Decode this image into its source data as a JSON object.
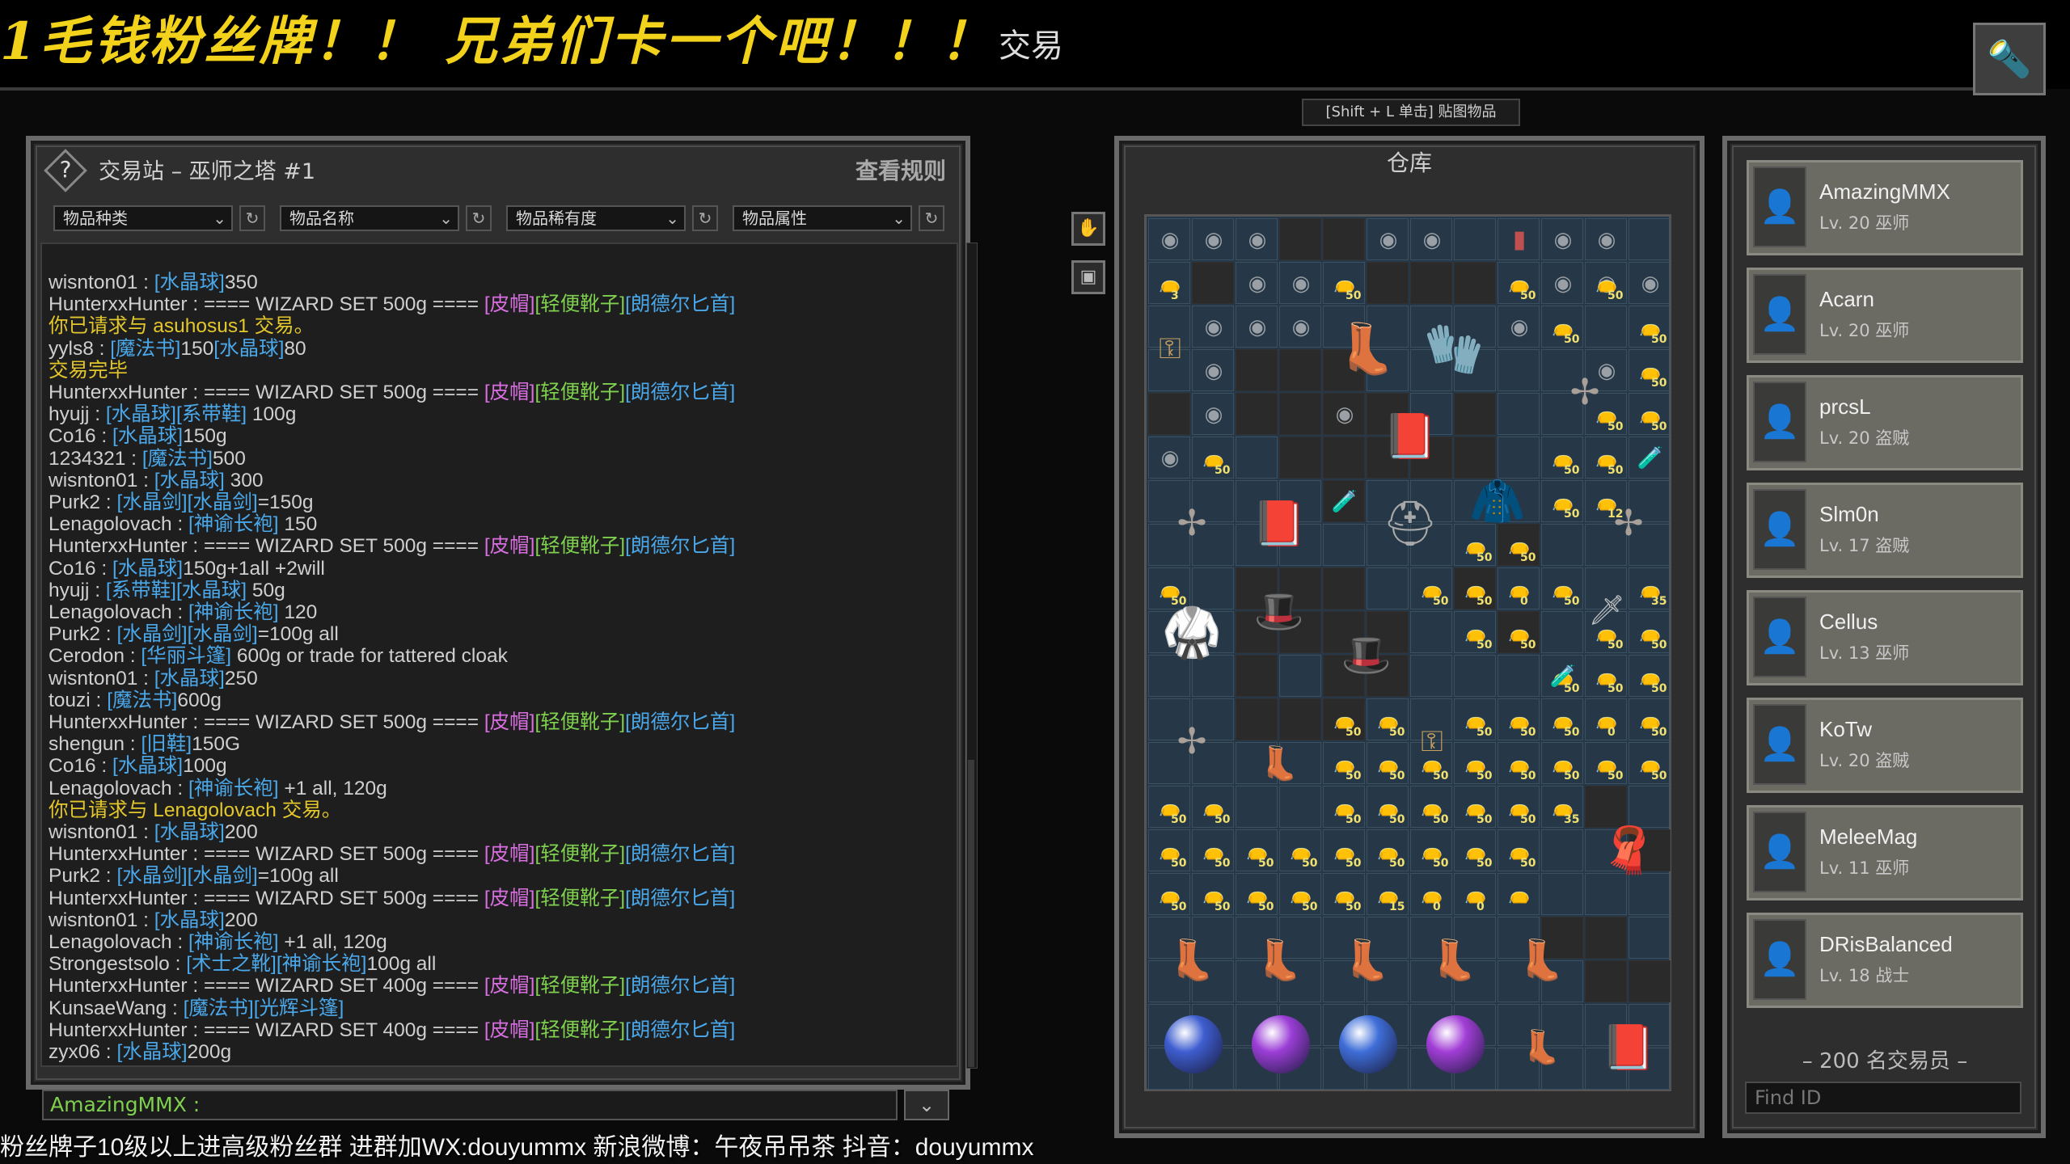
{
  "overlay": {
    "banner": "1毛钱粉丝牌！！ 兄弟们卡一个吧！！！",
    "footer": "粉丝牌子10级以上进高级粉丝群  进群加WX:douyummx 新浪微博：午夜吊吊茶   抖音：douyummx"
  },
  "header": {
    "title": "交易",
    "paste_hint": "[Shift + L 单击] 贴图物品"
  },
  "trade_panel": {
    "title": "交易站 – 巫师之塔 #1",
    "rules_label": "查看规则",
    "filters": [
      "物品种类",
      "物品名称",
      "物品稀有度",
      "物品属性"
    ],
    "input_prefix": "AmazingMMX :",
    "messages": [
      [
        [
          "wisnton01 : ",
          "w"
        ],
        [
          "[水晶球]",
          "b"
        ],
        [
          "350",
          "w"
        ]
      ],
      [
        [
          "HunterxxHunter : ==== WIZARD SET 500g ==== ",
          "w"
        ],
        [
          "[皮帽]",
          "p"
        ],
        [
          "[轻便靴子]",
          "g"
        ],
        [
          "[朗德尔匕首]",
          "b"
        ]
      ],
      [
        [
          "你已请求与 asuhosus1 交易。",
          "y"
        ]
      ],
      [
        [
          "yyls8 : ",
          "w"
        ],
        [
          "[魔法书]",
          "b"
        ],
        [
          "150",
          "w"
        ],
        [
          "[水晶球]",
          "b"
        ],
        [
          "80",
          "w"
        ]
      ],
      [
        [
          "交易完毕",
          "y"
        ]
      ],
      [
        [
          "HunterxxHunter : ==== WIZARD SET 500g ==== ",
          "w"
        ],
        [
          "[皮帽]",
          "p"
        ],
        [
          "[轻便靴子]",
          "g"
        ],
        [
          "[朗德尔匕首]",
          "b"
        ]
      ],
      [
        [
          "hyujj : ",
          "w"
        ],
        [
          "[水晶球]",
          "b"
        ],
        [
          "[系带鞋]",
          "b"
        ],
        [
          " 100g",
          "w"
        ]
      ],
      [
        [
          "Co16 : ",
          "w"
        ],
        [
          "[水晶球]",
          "b"
        ],
        [
          "150g",
          "w"
        ]
      ],
      [
        [
          "1234321 : ",
          "w"
        ],
        [
          "[魔法书]",
          "b"
        ],
        [
          "500",
          "w"
        ]
      ],
      [
        [
          "wisnton01 : ",
          "w"
        ],
        [
          "[水晶球]",
          "b"
        ],
        [
          " 300",
          "w"
        ]
      ],
      [
        [
          "Purk2 : ",
          "w"
        ],
        [
          "[水晶剑]",
          "b"
        ],
        [
          "[水晶剑]",
          "b"
        ],
        [
          "=150g",
          "w"
        ]
      ],
      [
        [
          "Lenagolovach : ",
          "w"
        ],
        [
          "[神谕长袍]",
          "b"
        ],
        [
          " 150",
          "w"
        ]
      ],
      [
        [
          "HunterxxHunter : ==== WIZARD SET 500g ==== ",
          "w"
        ],
        [
          "[皮帽]",
          "p"
        ],
        [
          "[轻便靴子]",
          "g"
        ],
        [
          "[朗德尔匕首]",
          "b"
        ]
      ],
      [
        [
          "Co16 : ",
          "w"
        ],
        [
          "[水晶球]",
          "b"
        ],
        [
          "150g+1all   +2will",
          "w"
        ]
      ],
      [
        [
          "hyujj : ",
          "w"
        ],
        [
          "[系带鞋]",
          "b"
        ],
        [
          "[水晶球]",
          "b"
        ],
        [
          " 50g",
          "w"
        ]
      ],
      [
        [
          "Lenagolovach : ",
          "w"
        ],
        [
          "[神谕长袍]",
          "b"
        ],
        [
          " 120",
          "w"
        ]
      ],
      [
        [
          "Purk2 : ",
          "w"
        ],
        [
          "[水晶剑]",
          "b"
        ],
        [
          "[水晶剑]",
          "b"
        ],
        [
          "=100g  all",
          "w"
        ]
      ],
      [
        [
          "Cerodon : ",
          "w"
        ],
        [
          "[华丽斗篷]",
          "b"
        ],
        [
          " 600g or trade for tattered cloak",
          "w"
        ]
      ],
      [
        [
          "wisnton01 : ",
          "w"
        ],
        [
          "[水晶球]",
          "b"
        ],
        [
          "250",
          "w"
        ]
      ],
      [
        [
          "touzi : ",
          "w"
        ],
        [
          "[魔法书]",
          "b"
        ],
        [
          "600g",
          "w"
        ]
      ],
      [
        [
          "HunterxxHunter : ==== WIZARD SET 500g ==== ",
          "w"
        ],
        [
          "[皮帽]",
          "p"
        ],
        [
          "[轻便靴子]",
          "g"
        ],
        [
          "[朗德尔匕首]",
          "b"
        ]
      ],
      [
        [
          "shengun : ",
          "w"
        ],
        [
          "[旧鞋]",
          "b"
        ],
        [
          "150G",
          "w"
        ]
      ],
      [
        [
          "Co16 : ",
          "w"
        ],
        [
          "[水晶球]",
          "b"
        ],
        [
          "100g",
          "w"
        ]
      ],
      [
        [
          "Lenagolovach : ",
          "w"
        ],
        [
          "[神谕长袍]",
          "b"
        ],
        [
          " +1 all, 120g",
          "w"
        ]
      ],
      [
        [
          "你已请求与 Lenagolovach 交易。",
          "y"
        ]
      ],
      [
        [
          "wisnton01 : ",
          "w"
        ],
        [
          "[水晶球]",
          "b"
        ],
        [
          "200",
          "w"
        ]
      ],
      [
        [
          "HunterxxHunter : ==== WIZARD SET 500g ==== ",
          "w"
        ],
        [
          "[皮帽]",
          "p"
        ],
        [
          "[轻便靴子]",
          "g"
        ],
        [
          "[朗德尔匕首]",
          "b"
        ]
      ],
      [
        [
          "Purk2 : ",
          "w"
        ],
        [
          "[水晶剑]",
          "b"
        ],
        [
          "[水晶剑]",
          "b"
        ],
        [
          "=100g all",
          "w"
        ]
      ],
      [
        [
          "HunterxxHunter : ==== WIZARD SET 500g ==== ",
          "w"
        ],
        [
          "[皮帽]",
          "p"
        ],
        [
          "[轻便靴子]",
          "g"
        ],
        [
          "[朗德尔匕首]",
          "b"
        ]
      ],
      [
        [
          "wisnton01 : ",
          "w"
        ],
        [
          "[水晶球]",
          "b"
        ],
        [
          "200",
          "w"
        ]
      ],
      [
        [
          "Lenagolovach : ",
          "w"
        ],
        [
          "[神谕长袍]",
          "b"
        ],
        [
          " +1 all, 120g",
          "w"
        ]
      ],
      [
        [
          "Strongestsolo : ",
          "w"
        ],
        [
          "[术士之靴]",
          "b"
        ],
        [
          "[神谕长袍]",
          "b"
        ],
        [
          "100g all",
          "w"
        ]
      ],
      [
        [
          "HunterxxHunter : ==== WIZARD SET 400g ==== ",
          "w"
        ],
        [
          "[皮帽]",
          "p"
        ],
        [
          "[轻便靴子]",
          "g"
        ],
        [
          "[朗德尔匕首]",
          "b"
        ]
      ],
      [
        [
          "KunsaeWang : ",
          "w"
        ],
        [
          "[魔法书]",
          "b"
        ],
        [
          "[光辉斗篷]",
          "b"
        ]
      ],
      [
        [
          "HunterxxHunter : ==== WIZARD SET 400g ==== ",
          "w"
        ],
        [
          "[皮帽]",
          "p"
        ],
        [
          "[轻便靴子]",
          "g"
        ],
        [
          "[朗德尔匕首]",
          "b"
        ]
      ],
      [
        [
          "zyx06 : ",
          "w"
        ],
        [
          "[水晶球]",
          "b"
        ],
        [
          "200g",
          "w"
        ]
      ]
    ]
  },
  "storage": {
    "title": "仓库",
    "quantities": [
      "3",
      "50",
      "50",
      "50",
      "50",
      "50",
      "50",
      "50",
      "50",
      "50",
      "50",
      "50",
      "50",
      "12",
      "50",
      "50",
      "50",
      "50",
      "50",
      "0",
      "50",
      "35",
      "50",
      "50",
      "50",
      "50",
      "50",
      "50",
      "50",
      "50",
      "50",
      "50",
      "50",
      "50",
      "0",
      "50",
      "50",
      "50",
      "50",
      "50",
      "50",
      "50",
      "50",
      "50",
      "50",
      "50",
      "50",
      "50",
      "50",
      "50",
      "50",
      "35",
      "50",
      "50",
      "50",
      "50",
      "50",
      "50",
      "50",
      "50",
      "50",
      "50",
      "50",
      "50",
      "50",
      "50",
      "15",
      "0",
      "0"
    ]
  },
  "traders": {
    "list": [
      {
        "name": "AmazingMMX",
        "level": "Lv. 20 巫师"
      },
      {
        "name": "Acarn",
        "level": "Lv. 20 巫师"
      },
      {
        "name": "prcsL",
        "level": "Lv. 20 盗贼"
      },
      {
        "name": "Slm0n",
        "level": "Lv. 17 盗贼"
      },
      {
        "name": "Cellus",
        "level": "Lv. 13 巫师"
      },
      {
        "name": "KoTw",
        "level": "Lv. 20 盗贼"
      },
      {
        "name": "MeleeMag",
        "level": "Lv. 11 巫师"
      },
      {
        "name": "DRisBalanced",
        "level": "Lv. 18 战士"
      }
    ],
    "count_label": "– 200 名交易员 –",
    "find_placeholder": "Find ID"
  },
  "colors": {
    "banner": "#f3d21b",
    "item_blue": "#4aa8ea",
    "item_pink": "#d86ee0",
    "item_green": "#7ed04e",
    "system_yellow": "#e3c72b"
  }
}
